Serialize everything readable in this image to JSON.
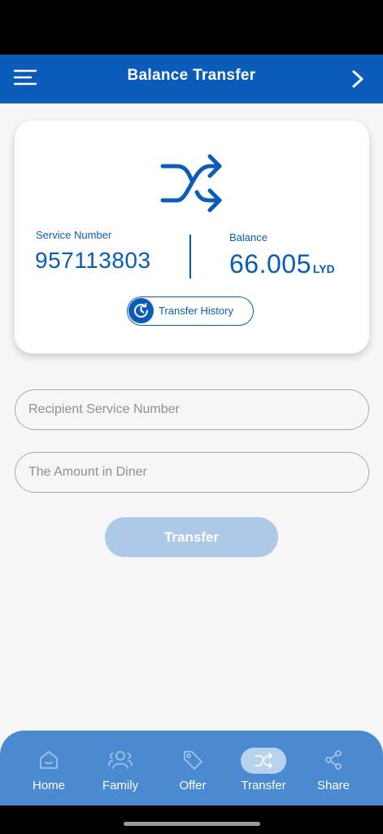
{
  "header": {
    "title": "Balance Transfer",
    "menu_icon": "hamburger-menu-icon",
    "forward_icon": "chevron-right-icon"
  },
  "card": {
    "logo_icon": "shuffle-transfer-icon",
    "service_number_label": "Service Number",
    "service_number_value": "957113803",
    "balance_label": "Balance",
    "balance_value": "66.005",
    "balance_unit": "LYD",
    "history_button_label": "Transfer History",
    "history_icon": "clock-history-icon"
  },
  "form": {
    "recipient_placeholder": "Recipient Service Number",
    "recipient_value": "",
    "amount_placeholder": "The Amount in Diner",
    "amount_value": "",
    "submit_label": "Transfer"
  },
  "bottom_nav": {
    "items": [
      {
        "label": "Home",
        "icon": "home-icon",
        "active": false
      },
      {
        "label": "Family",
        "icon": "family-icon",
        "active": false
      },
      {
        "label": "Offer",
        "icon": "tag-icon",
        "active": false
      },
      {
        "label": "Transfer",
        "icon": "shuffle-icon",
        "active": true
      },
      {
        "label": "Share",
        "icon": "share-icon",
        "active": false
      }
    ]
  },
  "colors": {
    "primary": "#0b5cb8",
    "nav_background": "#4b8ad0",
    "disabled_button": "#acc9e8",
    "active_nav_pill": "#b7d2ef",
    "page_background": "#f6f6f7"
  }
}
